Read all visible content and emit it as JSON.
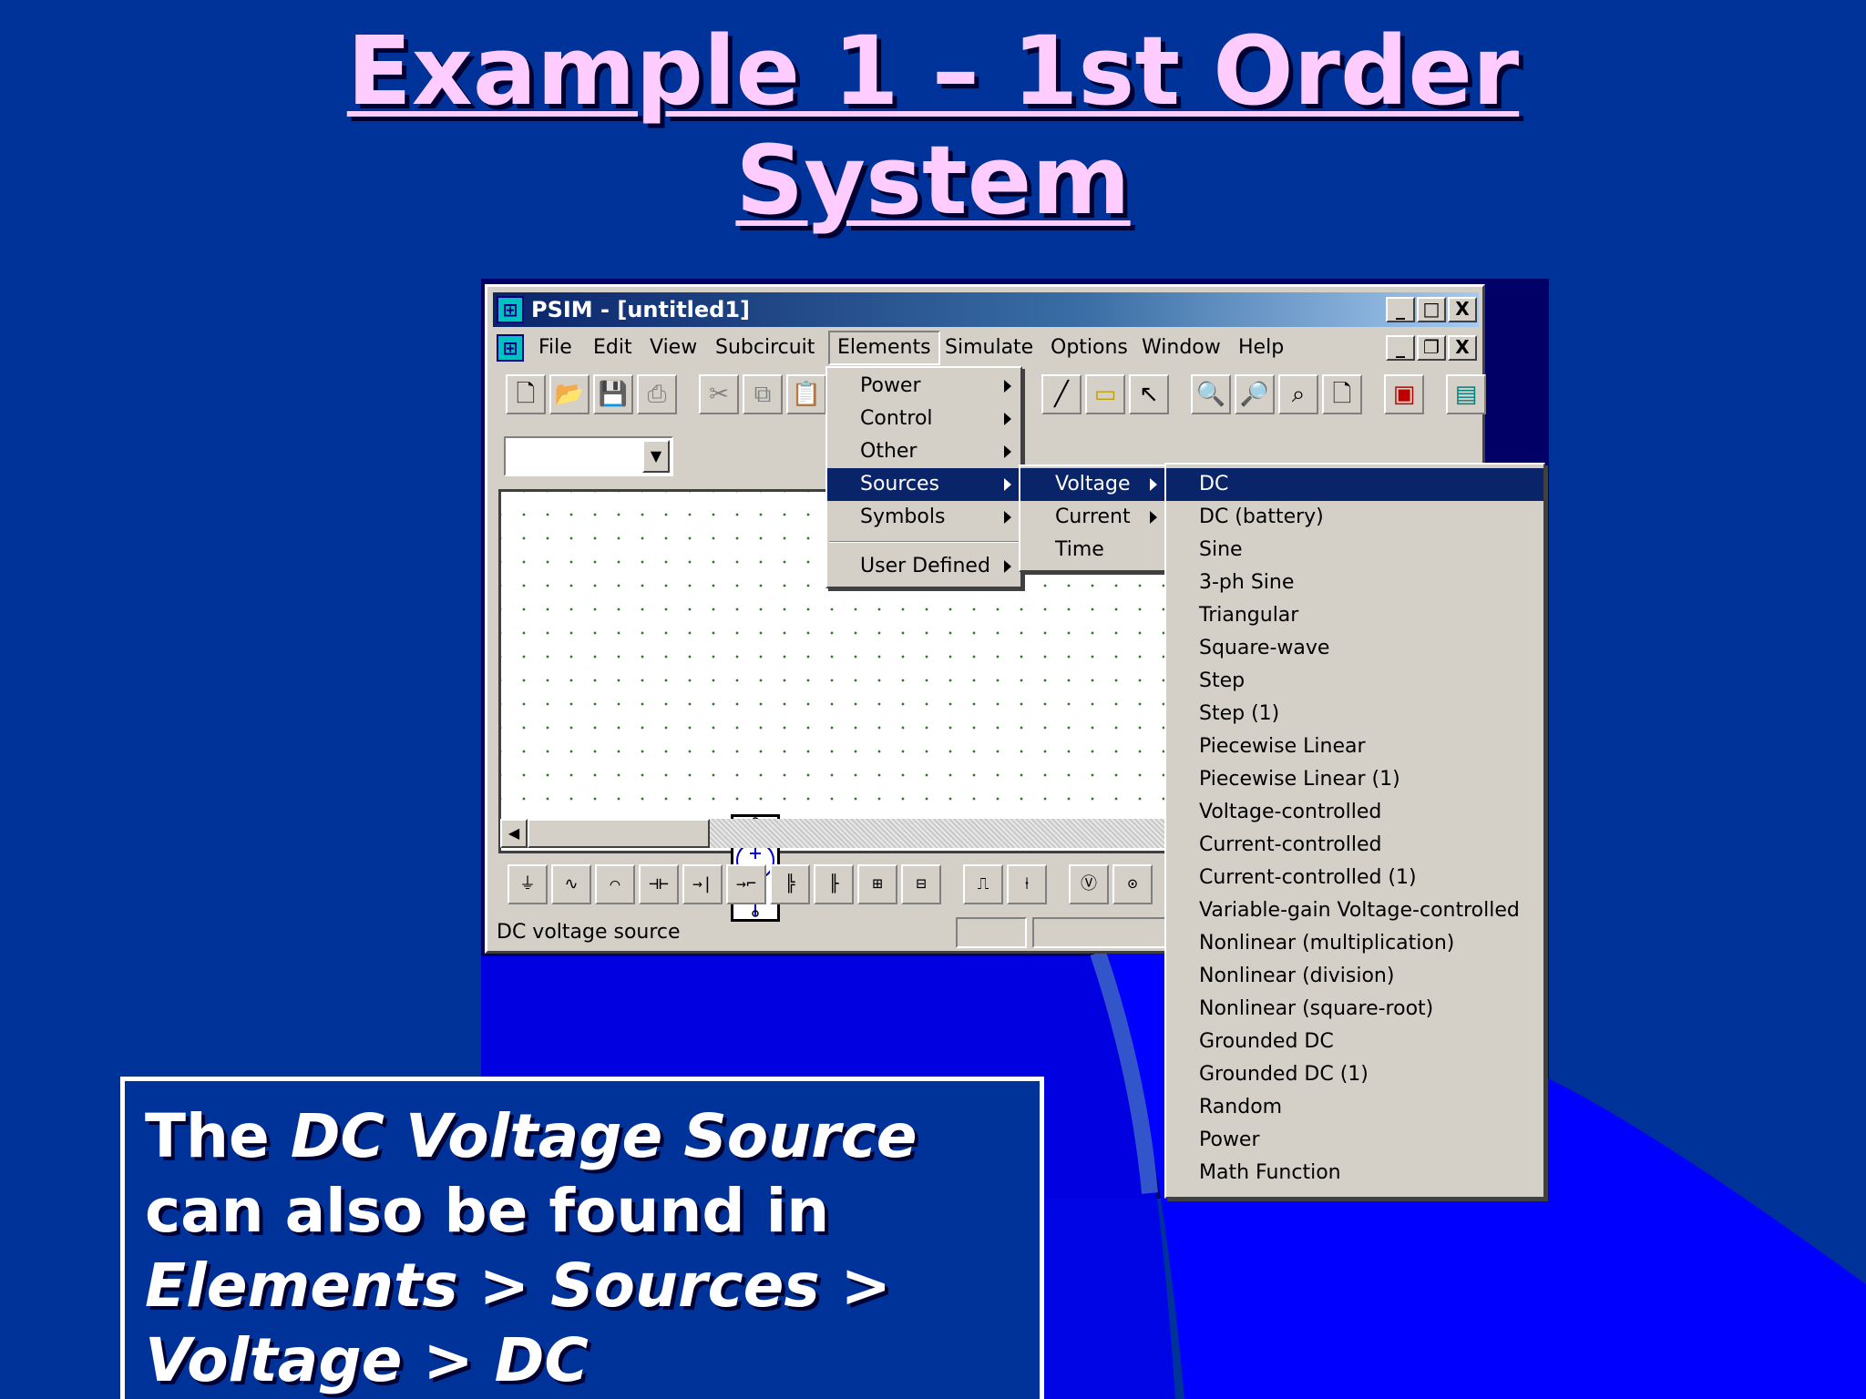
{
  "slide": {
    "title_line1": "Example 1 – 1st Order",
    "title_line2": "System",
    "caption": {
      "part1": "The ",
      "part2": "DC Voltage Source",
      "part3": " can also be found in ",
      "part4": "Elements > Sources > Voltage > DC"
    }
  },
  "window": {
    "title": "PSIM - [untitled1]",
    "title_buttons": [
      "_",
      "□",
      "X"
    ],
    "menubar": [
      "File",
      "Edit",
      "View",
      "Subcircuit",
      "Elements",
      "Simulate",
      "Options",
      "Window",
      "Help"
    ],
    "doc_buttons": [
      "_",
      "❐",
      "X"
    ],
    "toolbar_icons": [
      "new-icon",
      "open-icon",
      "save-icon",
      "print-icon",
      "cut-icon",
      "copy-icon",
      "paste-icon",
      "wire-icon",
      "label-icon",
      "pointer-icon",
      "zoom-in-icon",
      "zoom-out-icon",
      "zoom-fit-icon",
      "page-icon",
      "run-icon",
      "simview-icon"
    ],
    "combo_value": "",
    "status_text": "DC voltage source",
    "element_icons": [
      "ground-icon",
      "resistor-icon",
      "inductor-icon",
      "capacitor-icon",
      "diode-icon",
      "zener-icon",
      "mosfet-icon",
      "igbt-icon",
      "thyristor-icon",
      "gto-icon",
      "pulse-source-icon",
      "dc-source-icon",
      "voltmeter-icon",
      "voltage-probe-icon"
    ]
  },
  "menus": {
    "elements": {
      "items": [
        "Power",
        "Control",
        "Other",
        "Sources",
        "Symbols",
        "User Defined"
      ],
      "selected": "Sources"
    },
    "sources": {
      "items": [
        "Voltage",
        "Current",
        "Time"
      ],
      "selected": "Voltage"
    },
    "voltage": {
      "items": [
        "DC",
        "DC (battery)",
        "Sine",
        "3-ph Sine",
        "Triangular",
        "Square-wave",
        "Step",
        "Step (1)",
        "Piecewise Linear",
        "Piecewise Linear (1)",
        "Voltage-controlled",
        "Current-controlled",
        "Current-controlled (1)",
        "Variable-gain Voltage-controlled",
        "Nonlinear (multiplication)",
        "Nonlinear (division)",
        "Nonlinear (square-root)",
        "Grounded DC",
        "Grounded DC (1)",
        "Random",
        "Power",
        "Math Function"
      ],
      "selected": "DC"
    }
  },
  "colors": {
    "background": "#003399",
    "title": "#ffccff",
    "menu_highlight": "#0a246a"
  }
}
